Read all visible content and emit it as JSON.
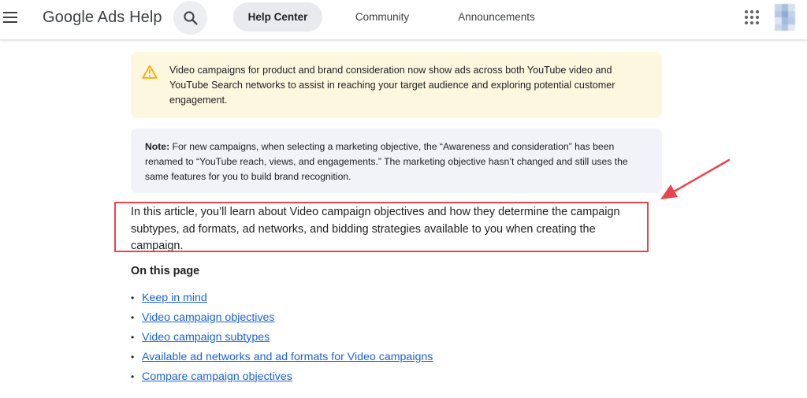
{
  "header": {
    "brand": "Google Ads Help",
    "tabs": [
      {
        "label": "Help Center",
        "active": true
      },
      {
        "label": "Community",
        "active": false
      },
      {
        "label": "Announcements",
        "active": false
      }
    ],
    "icons": {
      "menu": "hamburger-menu-icon",
      "search": "search-icon",
      "apps": "apps-grid-icon"
    }
  },
  "callouts": {
    "warning_text": "Video campaigns for product and brand consideration now show ads across both YouTube video and YouTube Search networks to assist in reaching your target audience and exploring potential customer engagement.",
    "note_label": "Note:",
    "note_text": " For new campaigns, when selecting a marketing objective, the “Awareness and consideration” has been renamed to “YouTube reach, views, and engagements.” The marketing objective hasn’t changed and still uses the same features for you to build brand recognition."
  },
  "intro": "In this article, you’ll learn about Video campaign objectives and how they determine the campaign subtypes, ad formats, ad networks, and bidding strategies available to you when creating the campaign.",
  "toc": {
    "title": "On this page",
    "items": [
      {
        "label": "Keep in mind"
      },
      {
        "label": "Video campaign objectives"
      },
      {
        "label": "Video campaign subtypes"
      },
      {
        "label": "Available ad networks and ad formats for Video campaigns"
      },
      {
        "label": "Compare campaign objectives"
      }
    ]
  },
  "colors": {
    "warning_bg": "#fef7e0",
    "warning_icon": "#f9ab00",
    "note_bg": "#f1f3f9",
    "link": "#1a62d6",
    "annotation": "#e9454f",
    "active_tab_bg": "#e8eaef"
  }
}
